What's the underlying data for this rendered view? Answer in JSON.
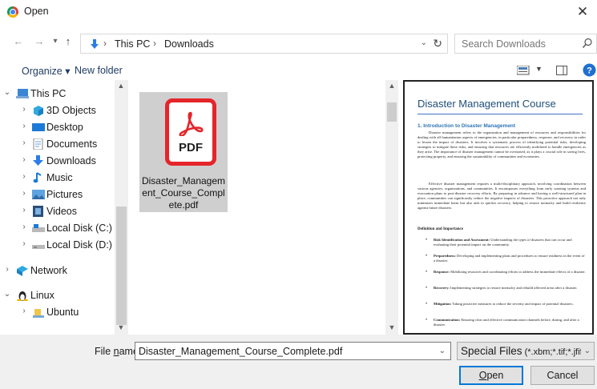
{
  "window": {
    "title": "Open",
    "close": "✕"
  },
  "nav": {
    "back": "←",
    "forward": "→",
    "recent": "⌄",
    "up": "↑",
    "crumbs": [
      "This PC",
      "Downloads"
    ],
    "sep": "›",
    "search_placeholder": "Search Downloads"
  },
  "toolbar": {
    "organize": "Organize ▾",
    "new_folder": "New folder"
  },
  "tree": [
    {
      "label": "This PC",
      "icon": "pc-icon"
    },
    {
      "label": "3D Objects",
      "icon": "3d-objects-icon"
    },
    {
      "label": "Desktop",
      "icon": "desktop-icon"
    },
    {
      "label": "Documents",
      "icon": "documents-icon"
    },
    {
      "label": "Downloads",
      "icon": "downloads-icon"
    },
    {
      "label": "Music",
      "icon": "music-icon"
    },
    {
      "label": "Pictures",
      "icon": "pictures-icon"
    },
    {
      "label": "Videos",
      "icon": "videos-icon"
    },
    {
      "label": "Local Disk (C:)",
      "icon": "disk-icon"
    },
    {
      "label": "Local Disk (D:)",
      "icon": "disk-icon"
    },
    {
      "label": "Network",
      "icon": "network-icon"
    },
    {
      "label": "Linux",
      "icon": "linux-icon"
    },
    {
      "label": "Ubuntu",
      "icon": "ubuntu-folder-icon"
    }
  ],
  "file": {
    "pdf_badge": "PDF",
    "name": "Disaster_Management_Course_Complete.pdf"
  },
  "preview": {
    "title": "Disaster Management Course",
    "section1": "1. Introduction to Disaster Management",
    "para1": "Disaster management refers to the organization and management of resources and responsibilities for dealing with all humanitarian aspects of emergencies, in particular preparedness, response, and recovery in order to lessen the impact of disasters. It involves a systematic process of identifying potential risks, developing strategies to mitigate these risks, and ensuring that resources are efficiently mobilized to handle emergencies as they arise. The importance of disaster management cannot be overstated, as it plays a crucial role in saving lives, protecting property, and ensuring the sustainability of communities and economies.",
    "para2": "Effective disaster management requires a multi-disciplinary approach, involving coordination between various agencies, organizations, and communities. It encompasses everything from early warning systems and evacuation plans to post-disaster recovery efforts. By preparing in advance and having a well-structured plan in place, communities can significantly reduce the negative impacts of disasters. This proactive approach not only minimizes immediate harm but also aids in quicker recovery, helping to restore normalcy and build resilience against future disasters.",
    "def_heading": "Definition and Importance",
    "bullets": [
      {
        "term": "Risk Identification and Assessment:",
        "text": " Understanding the types of disasters that can occur and evaluating their potential impact on the community."
      },
      {
        "term": "Preparedness:",
        "text": " Developing and implementing plans and procedures to ensure readiness in the event of a disaster."
      },
      {
        "term": "Response:",
        "text": " Mobilizing resources and coordinating efforts to address the immediate effects of a disaster."
      },
      {
        "term": "Recovery:",
        "text": " Implementing strategies to restore normalcy and rebuild affected areas after a disaster."
      },
      {
        "term": "Mitigation:",
        "text": " Taking proactive measures to reduce the severity and impact of potential disasters."
      },
      {
        "term": "Communication:",
        "text": " Ensuring clear and effective communication channels before, during, and after a disaster."
      }
    ]
  },
  "bottom": {
    "filename_label_pre": "File ",
    "filename_label_ul": "n",
    "filename_label_post": "ame:",
    "filename_value": "Disaster_Management_Course_Complete.pdf",
    "filetype_main": "Special Files",
    "filetype_detail": " (*.xbm;*.tif;*.jfif;*.",
    "open_ul": "O",
    "open_rest": "pen",
    "cancel": "Cancel"
  },
  "colors": {
    "accent": "#0078d7",
    "pdf_red": "#e5252a",
    "selection": "#cfcfcf"
  }
}
